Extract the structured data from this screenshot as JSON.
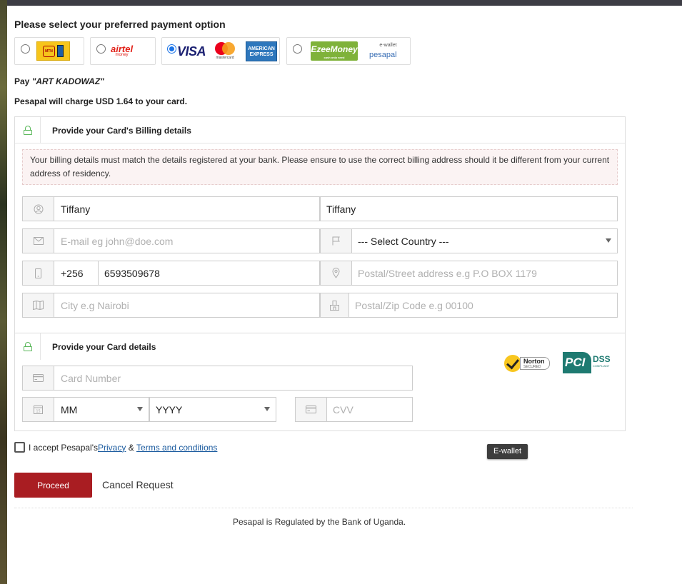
{
  "heading": "Please select your preferred payment option",
  "payment_options": {
    "mtn": {
      "text": "MTN Mobile Money",
      "selected": false
    },
    "airtel": {
      "text": "airtel",
      "sub": "money",
      "selected": false
    },
    "cards": {
      "visa": "VISA",
      "mastercard": "mastercard",
      "amex": "AMERICAN EXPRESS",
      "selected": true
    },
    "ezee": {
      "text": "EzeeMoney",
      "sub": "cash only need",
      "ewallet": "e-wallet",
      "pesapal": "pesapal",
      "selected": false
    }
  },
  "pay_label": "Pay ",
  "merchant": "\"ART KADOWAZ\"",
  "charge_text": "Pesapal will charge USD 1.64 to your card.",
  "billing": {
    "title": "Provide your Card's Billing details",
    "notice": "Your billing details must match the details registered at your bank. Please ensure to use the correct billing address should it be different from your current address of residency.",
    "first_name": "Tiffany",
    "last_name": "Tiffany",
    "email_placeholder": "E-mail eg john@doe.com",
    "country": "--- Select Country ---",
    "phone_code": "+256",
    "phone": "6593509678",
    "address_placeholder": "Postal/Street address e.g P.O BOX 1179",
    "city_placeholder": "City e.g Nairobi",
    "zip_placeholder": "Postal/Zip Code e.g 00100"
  },
  "card": {
    "title": "Provide your Card details",
    "number_placeholder": "Card Number",
    "month": "MM",
    "year": "YYYY",
    "cvv_placeholder": "CVV"
  },
  "badges": {
    "norton": "Norton",
    "norton_sub": "SECURED",
    "pci": "PCI",
    "dss": "DSS",
    "dss_sub": "COMPLIANT"
  },
  "tooltip": "E-wallet",
  "accept": {
    "prefix": "I accept Pesapal's ",
    "privacy": "Privacy",
    "amp": " & ",
    "terms": "Terms and conditions"
  },
  "proceed": "Proceed",
  "cancel": "Cancel Request",
  "footer": "Pesapal is Regulated by the Bank of Uganda.",
  "colors": {
    "proceed": "#a91d22",
    "lock": "#5cb85c",
    "link": "#1a5a9e"
  }
}
